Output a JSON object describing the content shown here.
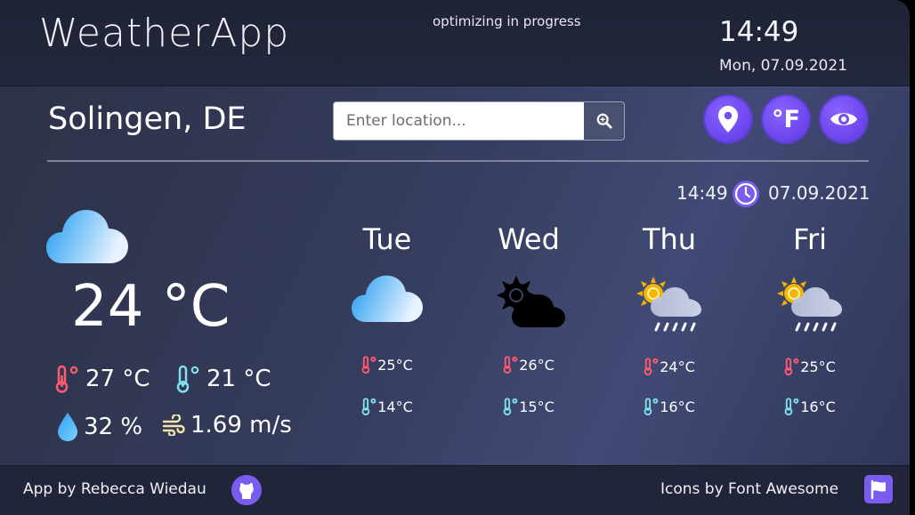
{
  "header": {
    "app_title": "WeatherApp",
    "status": "optimizing in progress",
    "time": "14:49",
    "date": "Mon, 07.09.2021"
  },
  "toolbar": {
    "city": "Solingen, DE",
    "search_placeholder": "Enter location...",
    "search_value": "",
    "unit_label": "°F"
  },
  "timestamp": {
    "time": "14:49",
    "date": "07.09.2021"
  },
  "current": {
    "temp": "24 °C",
    "high": "27 °C",
    "low": "21 °C",
    "humidity": "32 %",
    "wind": "1.69 m/s",
    "icon": "cloud-icon"
  },
  "forecast": [
    {
      "day": "Tue",
      "icon": "cloud-icon",
      "high": "25°C",
      "low": "14°C"
    },
    {
      "day": "Wed",
      "icon": "sun-cloud-icon",
      "high": "26°C",
      "low": "15°C"
    },
    {
      "day": "Thu",
      "icon": "sun-rain-icon",
      "high": "24°C",
      "low": "16°C"
    },
    {
      "day": "Fri",
      "icon": "sun-rain-icon",
      "high": "25°C",
      "low": "16°C"
    }
  ],
  "footer": {
    "author_credit": "App by Rebecca Wiedau",
    "icons_credit": "Icons by Font Awesome"
  },
  "colors": {
    "accent": "#7b5cf0",
    "hot": "#ff5a6e",
    "cold": "#7fe0ec",
    "cloud_blue": "#3aa6f5"
  }
}
